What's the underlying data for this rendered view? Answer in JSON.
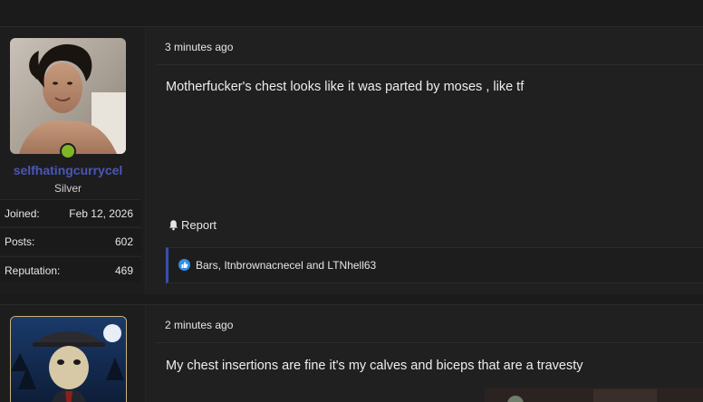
{
  "posts": [
    {
      "user": {
        "username": "selfhatingcurrycel",
        "rank": "Silver",
        "avatar_icon": "user-avatar-photo",
        "online": true,
        "stats": [
          {
            "label": "Joined:",
            "value": "Feb 12, 2026"
          },
          {
            "label": "Posts:",
            "value": "602"
          },
          {
            "label": "Reputation:",
            "value": "469"
          }
        ]
      },
      "timestamp": "3 minutes ago",
      "message": "Motherfucker's chest looks like it was parted by moses , like tf",
      "report_label": "Report",
      "reactions": "Bars, Itnbrownacnecel and LTNhell63"
    },
    {
      "user": {
        "avatar_icon": "user-avatar-masked-figure"
      },
      "timestamp": "2 minutes ago",
      "message": "My chest insertions are fine it's my calves and biceps that are a travesty"
    }
  ],
  "colors": {
    "background": "#1b1b1c",
    "post_bg": "#202021",
    "username": "#4a57b8",
    "online": "#7fb526",
    "reaction_bar": "#3a4fa8",
    "like": "#2f8fe6"
  }
}
